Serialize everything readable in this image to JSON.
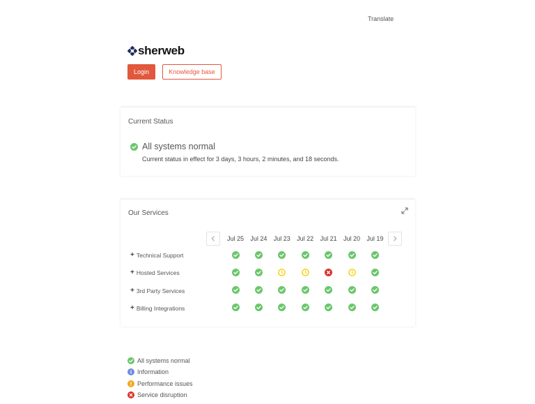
{
  "header": {
    "translate_label": "Translate"
  },
  "brand": {
    "name": "sherweb",
    "color": "#1c2d5a"
  },
  "actions": {
    "login_label": "Login",
    "kb_label": "Knowledge base"
  },
  "colors": {
    "accent": "#e2583c",
    "ok": "#6cc66c",
    "warning": "#f5d20f",
    "error": "#d9322a",
    "info": "#6f8ed8",
    "performance": "#f1a81d"
  },
  "current_status": {
    "title": "Current Status",
    "headline": "All systems normal",
    "detail": "Current status in effect for 3 days, 3 hours, 2 minutes, and 18 seconds.",
    "icon": "check-circle-icon"
  },
  "services": {
    "title": "Our Services",
    "dates": [
      "Jul 25",
      "Jul 24",
      "Jul 23",
      "Jul 22",
      "Jul 21",
      "Jul 20",
      "Jul 19"
    ],
    "rows": [
      {
        "label": "Technical Support",
        "statuses": [
          "ok",
          "ok",
          "ok",
          "ok",
          "ok",
          "ok",
          "ok"
        ]
      },
      {
        "label": "Hosted Services",
        "statuses": [
          "ok",
          "ok",
          "warning",
          "warning",
          "error",
          "warning",
          "ok"
        ]
      },
      {
        "label": "3rd Party Services",
        "statuses": [
          "ok",
          "ok",
          "ok",
          "ok",
          "ok",
          "ok",
          "ok"
        ]
      },
      {
        "label": "Billing Integrations",
        "statuses": [
          "ok",
          "ok",
          "ok",
          "ok",
          "ok",
          "ok",
          "ok"
        ]
      }
    ]
  },
  "legend": [
    {
      "label": "All systems normal",
      "icon": "ok"
    },
    {
      "label": "Information",
      "icon": "info"
    },
    {
      "label": "Performance issues",
      "icon": "performance"
    },
    {
      "label": "Service disruption",
      "icon": "error"
    }
  ]
}
